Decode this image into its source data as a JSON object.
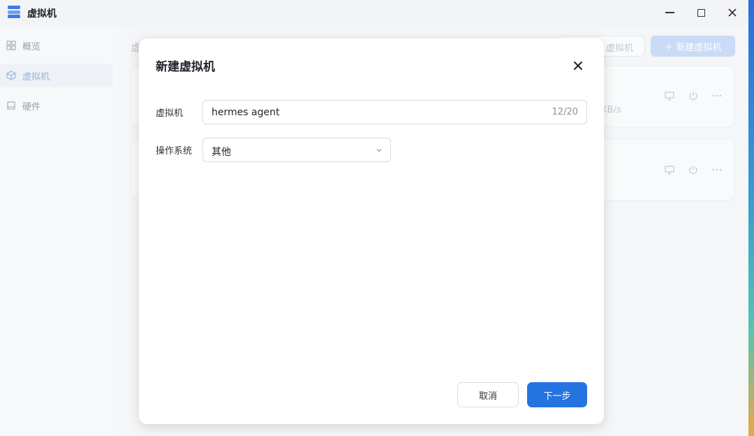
{
  "window": {
    "title": "虚拟机",
    "controls": [
      "minimize-icon",
      "maximize-icon",
      "close-icon"
    ]
  },
  "sidebar": {
    "items": [
      {
        "label": "概览",
        "icon": "grid-icon",
        "active": false
      },
      {
        "label": "虚拟机",
        "icon": "cube-icon",
        "active": true
      },
      {
        "label": "硬件",
        "icon": "drive-icon",
        "active": false
      }
    ]
  },
  "background": {
    "page_title": "虚",
    "secondary_button": "虚拟机",
    "primary_button": "＋ 新建虚拟机",
    "card_speed": "KB/s"
  },
  "dialog": {
    "title": "新建虚拟机",
    "name_label": "虚拟机",
    "name_value": "hermes agent",
    "name_counter": "12/20",
    "os_label": "操作系统",
    "os_value": "其他",
    "cancel_label": "取消",
    "next_label": "下一步"
  },
  "colors": {
    "accent": "#2374e1",
    "accent_disabled": "#c9dbf6"
  }
}
